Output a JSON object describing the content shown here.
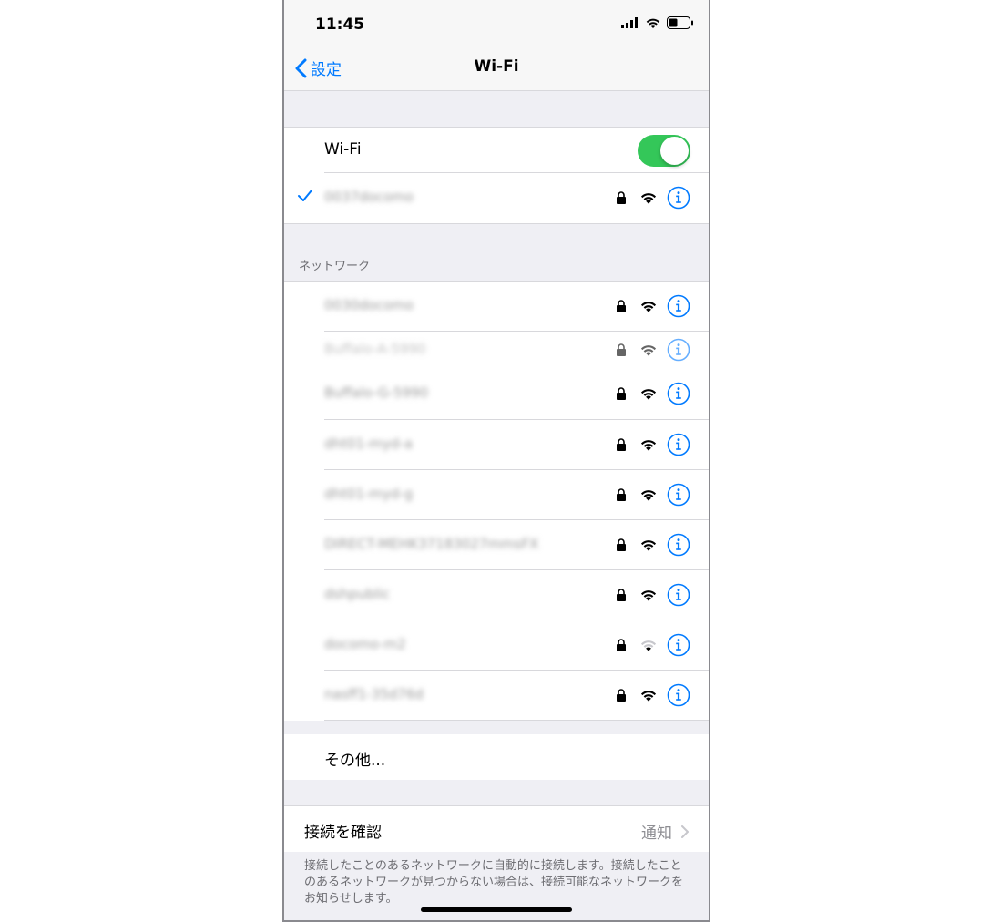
{
  "status_bar": {
    "time": "11:45"
  },
  "nav": {
    "back_label": "設定",
    "title": "Wi-Fi"
  },
  "wifi": {
    "label": "Wi-Fi",
    "enabled": true,
    "connected_network": "0037docomo"
  },
  "networks_section": {
    "header": "ネットワーク",
    "networks": [
      {
        "name": "0030docomo",
        "secured": true,
        "signal": "strong"
      },
      {
        "name": "Buffalo-G-5990",
        "secured": true,
        "signal": "strong"
      },
      {
        "name": "dht01-myd-a",
        "secured": true,
        "signal": "strong"
      },
      {
        "name": "dht01-myd-g",
        "secured": true,
        "signal": "strong"
      },
      {
        "name": "DIRECT-MEHK37183027mmsFX",
        "secured": true,
        "signal": "strong"
      },
      {
        "name": "dshpublic",
        "secured": true,
        "signal": "strong"
      },
      {
        "name": "docomo-m2",
        "secured": true,
        "signal": "weak"
      },
      {
        "name": "nasff1-35d76d",
        "secured": true,
        "signal": "strong"
      }
    ],
    "ghost_network": "Buffalo-A-5990",
    "other_label": "その他..."
  },
  "ask_to_join": {
    "label": "接続を確認",
    "value": "通知",
    "description": "接続したことのあるネットワークに自動的に接続します。接続したことのあるネットワークが見つからない場合は、接続可能なネットワークをお知らせします。"
  },
  "colors": {
    "accent": "#007aff",
    "toggle_on": "#34c759",
    "background": "#efeff4"
  }
}
